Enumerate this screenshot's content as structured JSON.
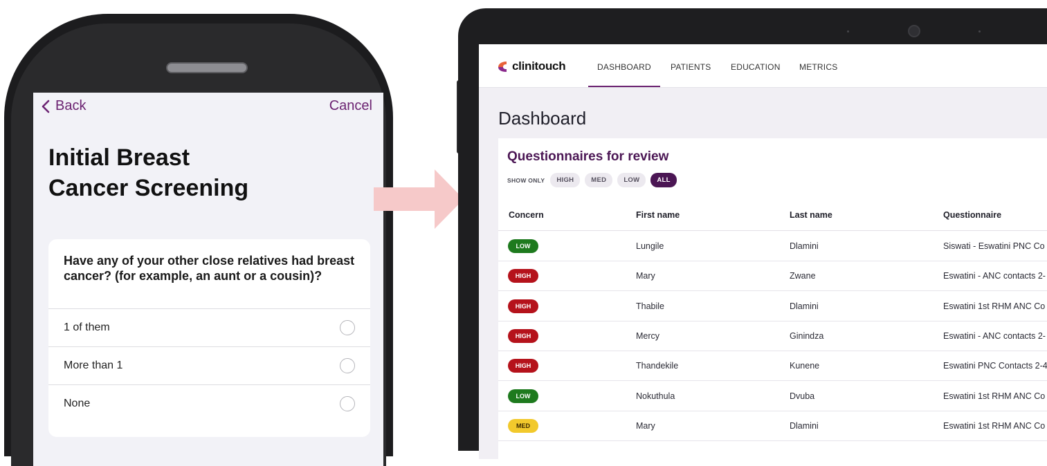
{
  "phone": {
    "nav": {
      "back_label": "Back",
      "cancel_label": "Cancel"
    },
    "title_line1": "Initial Breast",
    "title_line2": "Cancer Screening",
    "question": "Have any of your other close relatives had breast cancer? (for example, an aunt or a cousin)?",
    "options": [
      "1 of them",
      "More than 1",
      "None"
    ]
  },
  "tablet": {
    "brand": "clinitouch",
    "nav_tabs": [
      "DASHBOARD",
      "PATIENTS",
      "EDUCATION",
      "METRICS"
    ],
    "active_tab": "DASHBOARD",
    "page_title": "Dashboard",
    "panel_title": "Questionnaires for review",
    "filter_label": "SHOW ONLY",
    "filters": [
      "HIGH",
      "MED",
      "LOW",
      "ALL"
    ],
    "active_filter": "ALL",
    "columns": [
      "Concern",
      "First name",
      "Last name",
      "Questionnaire"
    ],
    "rows": [
      {
        "concern": "LOW",
        "first": "Lungile",
        "last": "Dlamini",
        "questionnaire": "Siswati - Eswatini PNC Co"
      },
      {
        "concern": "HIGH",
        "first": "Mary",
        "last": "Zwane",
        "questionnaire": "Eswatini - ANC contacts 2-"
      },
      {
        "concern": "HIGH",
        "first": "Thabile",
        "last": "Dlamini",
        "questionnaire": "Eswatini 1st RHM ANC Co"
      },
      {
        "concern": "HIGH",
        "first": "Mercy",
        "last": "Ginindza",
        "questionnaire": "Eswatini - ANC contacts 2-"
      },
      {
        "concern": "HIGH",
        "first": "Thandekile",
        "last": "Kunene",
        "questionnaire": "Eswatini PNC Contacts 2-4"
      },
      {
        "concern": "LOW",
        "first": "Nokuthula",
        "last": "Dvuba",
        "questionnaire": "Eswatini 1st RHM ANC Co"
      },
      {
        "concern": "MED",
        "first": "Mary",
        "last": "Dlamini",
        "questionnaire": "Eswatini 1st RHM ANC Co"
      }
    ]
  },
  "colors": {
    "brand_purple": "#4b1654",
    "accent_purple": "#6b2271",
    "high": "#b5121b",
    "med": "#f2c92c",
    "low": "#1e7a1e",
    "arrow": "#f6c9c9"
  },
  "icons": {
    "back": "chevron-left-icon",
    "radio": "radio-empty-icon",
    "logo": "clinitouch-logo-icon",
    "arrow": "right-arrow-icon"
  }
}
